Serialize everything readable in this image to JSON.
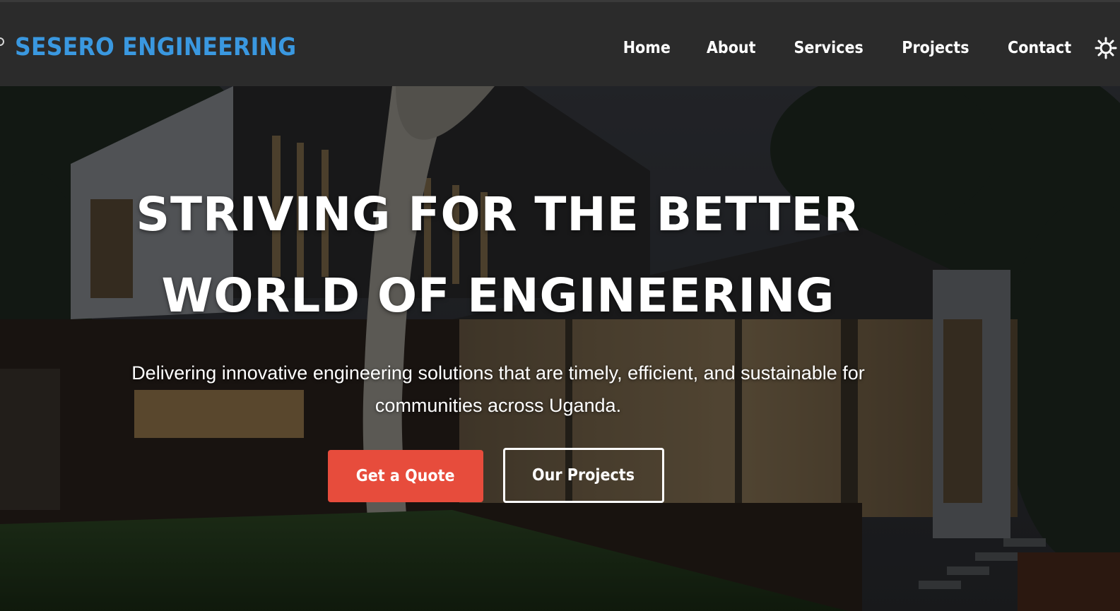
{
  "brand": {
    "name": "SESERO ENGINEERING",
    "color": "#3a98e0"
  },
  "nav": {
    "items": [
      {
        "label": "Home"
      },
      {
        "label": "About"
      },
      {
        "label": "Services"
      },
      {
        "label": "Projects"
      },
      {
        "label": "Contact"
      }
    ],
    "theme_icon": "sun-icon"
  },
  "hero": {
    "title_line1": "STRIVING FOR THE BETTER",
    "title_line2": "WORLD OF ENGINEERING",
    "subtitle": "Delivering innovative engineering solutions that are timely, efficient, and sustainable for communities across Uganda.",
    "primary_button": "Get a Quote",
    "secondary_button": "Our Projects",
    "background_image": "modern-house-at-night"
  },
  "colors": {
    "primary_button": "#e74c3c",
    "topbar": "#2b2b2b",
    "text": "#ffffff"
  }
}
